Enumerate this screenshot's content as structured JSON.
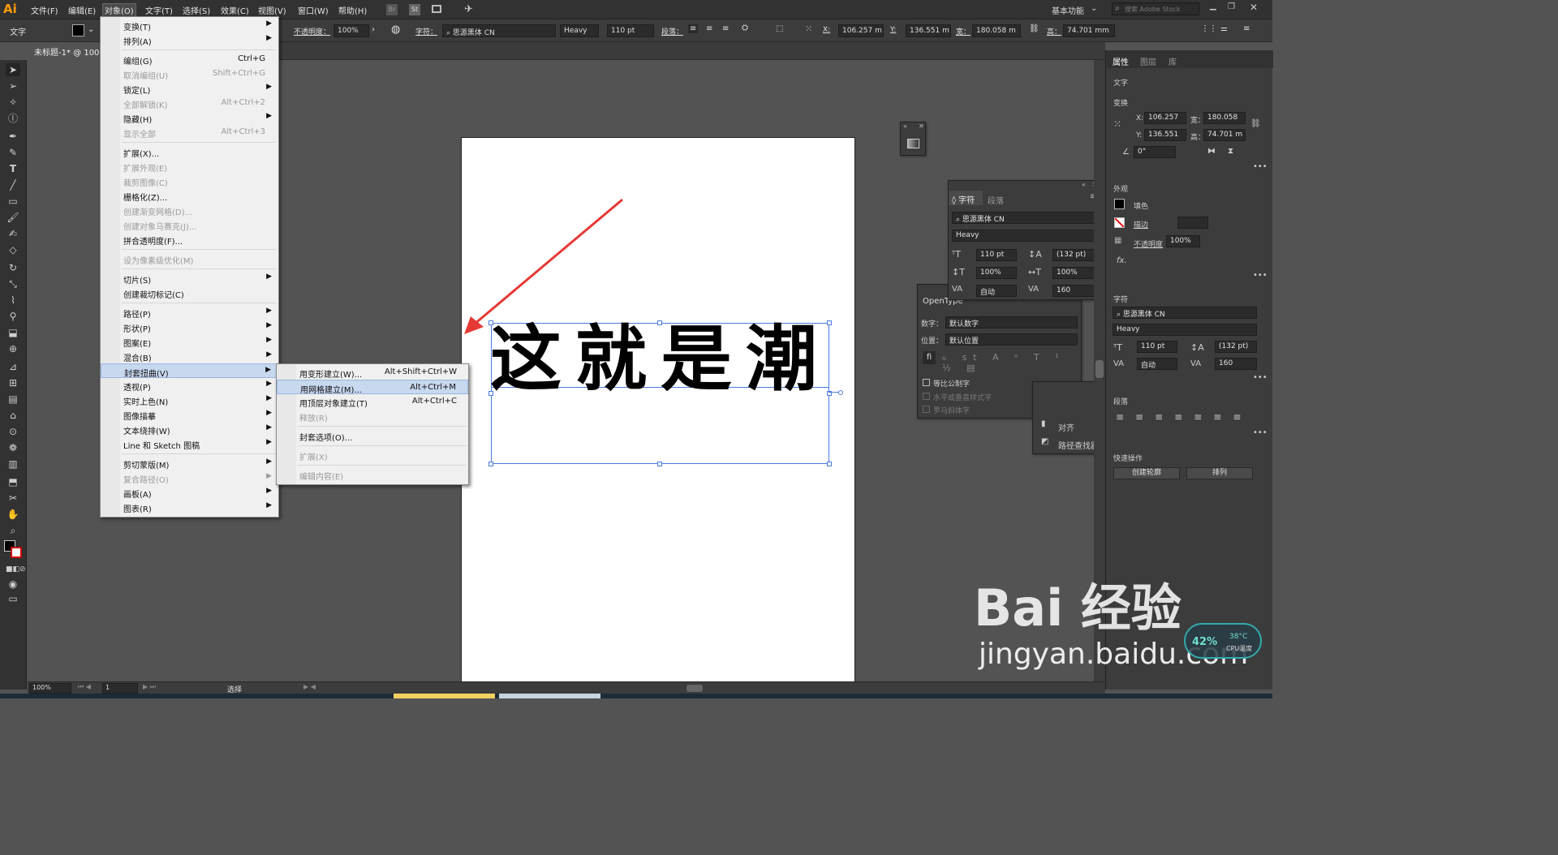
{
  "app": {
    "logo": "Ai",
    "workspace": "基本功能",
    "search_placeholder": "搜索 Adobe Stock",
    "bridge": "Br",
    "stock": "St"
  },
  "menubar": {
    "items": [
      "文件(F)",
      "编辑(E)",
      "对象(O)",
      "文字(T)",
      "选择(S)",
      "效果(C)",
      "视图(V)",
      "窗口(W)",
      "帮助(H)"
    ]
  },
  "control_bar": {
    "tool_label": "文字",
    "opacity_label": "不透明度：",
    "opacity_value": "100%",
    "char_label": "字符：",
    "font": "思源黑体 CN",
    "weight": "Heavy",
    "size": "110 pt",
    "para_label": "段落：",
    "x_label": "X:",
    "x": "106.257 m",
    "y_label": "Y:",
    "y": "136.551 m",
    "w_label": "宽：",
    "w": "180.058 m",
    "h_label": "高：",
    "h": "74.701 mm"
  },
  "document": {
    "tab": "未标题-1* @ 100%",
    "canvas_text": "这就是潮"
  },
  "object_menu": {
    "items": [
      {
        "label": "变换(T)",
        "shortcut": "",
        "sub": true,
        "disabled": false
      },
      {
        "label": "排列(A)",
        "shortcut": "",
        "sub": true,
        "disabled": false
      },
      {
        "label": "编组(G)",
        "shortcut": "Ctrl+G",
        "sub": false,
        "disabled": false
      },
      {
        "label": "取消编组(U)",
        "shortcut": "Shift+Ctrl+G",
        "sub": false,
        "disabled": true
      },
      {
        "label": "锁定(L)",
        "shortcut": "",
        "sub": true,
        "disabled": false
      },
      {
        "label": "全部解锁(K)",
        "shortcut": "Alt+Ctrl+2",
        "sub": false,
        "disabled": true
      },
      {
        "label": "隐藏(H)",
        "shortcut": "",
        "sub": true,
        "disabled": false
      },
      {
        "label": "显示全部",
        "shortcut": "Alt+Ctrl+3",
        "sub": false,
        "disabled": true
      },
      {
        "label": "扩展(X)...",
        "shortcut": "",
        "sub": false,
        "disabled": false
      },
      {
        "label": "扩展外观(E)",
        "shortcut": "",
        "sub": false,
        "disabled": true
      },
      {
        "label": "裁剪图像(C)",
        "shortcut": "",
        "sub": false,
        "disabled": true
      },
      {
        "label": "栅格化(Z)...",
        "shortcut": "",
        "sub": false,
        "disabled": false
      },
      {
        "label": "创建渐变网格(D)...",
        "shortcut": "",
        "sub": false,
        "disabled": true
      },
      {
        "label": "创建对象马赛克(J)...",
        "shortcut": "",
        "sub": false,
        "disabled": true
      },
      {
        "label": "拼合透明度(F)...",
        "shortcut": "",
        "sub": false,
        "disabled": false
      },
      {
        "label": "设为像素级优化(M)",
        "shortcut": "",
        "sub": false,
        "disabled": true
      },
      {
        "label": "切片(S)",
        "shortcut": "",
        "sub": true,
        "disabled": false
      },
      {
        "label": "创建裁切标记(C)",
        "shortcut": "",
        "sub": false,
        "disabled": false
      },
      {
        "label": "路径(P)",
        "shortcut": "",
        "sub": true,
        "disabled": false
      },
      {
        "label": "形状(P)",
        "shortcut": "",
        "sub": true,
        "disabled": false
      },
      {
        "label": "图案(E)",
        "shortcut": "",
        "sub": true,
        "disabled": false
      },
      {
        "label": "混合(B)",
        "shortcut": "",
        "sub": true,
        "disabled": false
      },
      {
        "label": "封套扭曲(V)",
        "shortcut": "",
        "sub": true,
        "disabled": false
      },
      {
        "label": "透视(P)",
        "shortcut": "",
        "sub": true,
        "disabled": false
      },
      {
        "label": "实时上色(N)",
        "shortcut": "",
        "sub": true,
        "disabled": false
      },
      {
        "label": "图像描摹",
        "shortcut": "",
        "sub": true,
        "disabled": false
      },
      {
        "label": "文本绕排(W)",
        "shortcut": "",
        "sub": true,
        "disabled": false
      },
      {
        "label": "Line 和 Sketch 图稿",
        "shortcut": "",
        "sub": true,
        "disabled": false
      },
      {
        "label": "剪切蒙版(M)",
        "shortcut": "",
        "sub": true,
        "disabled": false
      },
      {
        "label": "复合路径(O)",
        "shortcut": "",
        "sub": true,
        "disabled": true
      },
      {
        "label": "画板(A)",
        "shortcut": "",
        "sub": true,
        "disabled": false
      },
      {
        "label": "图表(R)",
        "shortcut": "",
        "sub": true,
        "disabled": false
      }
    ]
  },
  "envelope_submenu": {
    "items": [
      {
        "label": "用变形建立(W)...",
        "shortcut": "Alt+Shift+Ctrl+W",
        "disabled": false
      },
      {
        "label": "用网格建立(M)...",
        "shortcut": "Alt+Ctrl+M",
        "disabled": false
      },
      {
        "label": "用顶层对象建立(T)",
        "shortcut": "Alt+Ctrl+C",
        "disabled": false
      },
      {
        "label": "释放(R)",
        "shortcut": "",
        "disabled": true
      },
      {
        "label": "封套选项(O)...",
        "shortcut": "",
        "disabled": false
      },
      {
        "label": "扩展(X)",
        "shortcut": "",
        "disabled": true
      },
      {
        "label": "编辑内容(E)",
        "shortcut": "",
        "disabled": true
      }
    ]
  },
  "character_panel": {
    "tab1": "字符",
    "tab2": "段落",
    "font": "思源黑体 CN",
    "weight": "Heavy",
    "size": "110 pt",
    "leading": "(132 pt)",
    "vscale": "100%",
    "hscale": "100%",
    "kerning": "自动",
    "tracking": "160"
  },
  "opentype_panel": {
    "title": "OpenType",
    "num_label": "数字：",
    "num_value": "默认数字",
    "pos_label": "位置：",
    "pos_value": "默认位置",
    "cb1": "等比公制字",
    "cb2": "水平或垂直样式字",
    "cb3": "罗马斜体字"
  },
  "align_panel": {
    "align": "对齐",
    "pathfinder": "路径查找器"
  },
  "properties_panel": {
    "tabs": [
      "属性",
      "图层",
      "库"
    ],
    "type_label": "文字",
    "transform_label": "变换",
    "x_label": "X:",
    "x": "106.257",
    "y_label": "Y:",
    "y": "136.551",
    "w_label": "宽：",
    "w": "180.058",
    "h_label": "高：",
    "h": "74.701 m",
    "angle": "0°",
    "appearance_label": "外观",
    "fill_label": "填色",
    "stroke_label": "描边",
    "opacity_label": "不透明度",
    "opacity": "100%",
    "fx": "fx.",
    "char_label": "字符",
    "font": "思源黑体 CN",
    "weight": "Heavy",
    "size": "110 pt",
    "leading": "(132 pt)",
    "kerning": "自动",
    "tracking": "160",
    "para_label": "段落",
    "quick_label": "快速操作",
    "btn_outline": "创建轮廓",
    "btn_arrange": "排列"
  },
  "status": {
    "zoom": "100%",
    "page": "1",
    "tool": "选择"
  },
  "widget": {
    "percent": "42%",
    "temp": "38°C",
    "temp_label": "CPU温度"
  },
  "watermark": {
    "url": "jingyan.baidu.com",
    "brand": "Bai 经验"
  }
}
